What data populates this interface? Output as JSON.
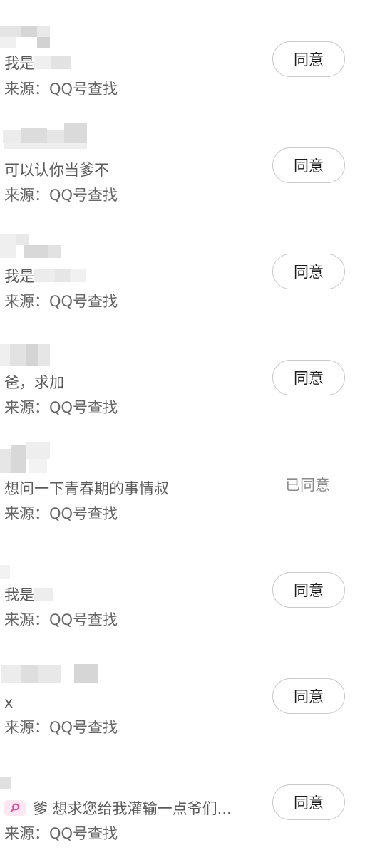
{
  "requests": [
    {
      "message": "我是",
      "source": "来源：QQ号查找",
      "action": "同意",
      "status": "pending"
    },
    {
      "message": "可以认你当爹不",
      "source": "来源：QQ号查找",
      "action": "同意",
      "status": "pending"
    },
    {
      "message": "我是",
      "source": "来源：QQ号查找",
      "action": "同意",
      "status": "pending"
    },
    {
      "message": "爸，求加",
      "source": "来源：QQ号查找",
      "action": "同意",
      "status": "pending"
    },
    {
      "message": "想问一下青春期的事情叔",
      "source": "来源：QQ号查找",
      "status_text": "已同意",
      "status": "accepted"
    },
    {
      "message": "我是",
      "source": "来源：QQ号查找",
      "action": "同意",
      "status": "pending"
    },
    {
      "message": "x",
      "source": "来源：QQ号查找",
      "action": "同意",
      "status": "pending"
    },
    {
      "message": "爹 想求您给我灌输一点爷们...",
      "message_icon": "search-tag-icon",
      "source": "来源：QQ号查找",
      "action": "同意",
      "status": "pending"
    }
  ],
  "colors": {
    "button_border": "#c8c8c8",
    "tag_bg": "#fde7f1",
    "tag_icon": "#e8479a"
  }
}
